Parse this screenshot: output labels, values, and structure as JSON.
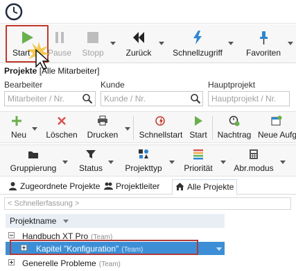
{
  "toolbar": {
    "start": "Start",
    "pause": "Pause",
    "stopp": "Stopp",
    "zurueck": "Zurück",
    "schnellzugriff": "Schnellzugriff",
    "favoriten": "Favoriten"
  },
  "section": {
    "title": "Projekte",
    "scope": "[Alle Mitarbeiter]"
  },
  "filters": {
    "bearbeiter": {
      "label": "Bearbeiter",
      "placeholder": "Mitarbeiter / Nr."
    },
    "kunde": {
      "label": "Kunde",
      "placeholder": "Kunde / Nr."
    },
    "hauptprojekt": {
      "label": "Hauptprojekt",
      "placeholder": "Hauptprojekt / Nr."
    }
  },
  "actions": {
    "neu": "Neu",
    "loeschen": "Löschen",
    "drucken": "Drucken",
    "schnellstart": "Schnellstart",
    "start": "Start",
    "nachtrag": "Nachtrag",
    "neue_aufg": "Neue Aufg"
  },
  "grouping": {
    "gruppierung": "Gruppierung",
    "status": "Status",
    "projekttyp": "Projekttyp",
    "prioritaet": "Priorität",
    "abr_modus": "Abr.modus"
  },
  "tabs": {
    "zugeordnete": "Zugeordnete Projekte",
    "projektleiter": "Projektleiter",
    "alle": "Alle Projekte"
  },
  "quick_entry": "< Schnellerfassung >",
  "tree": {
    "header": "Projektname",
    "rows": [
      {
        "name": "Handbuch XT Pro",
        "tag": "(Team)"
      },
      {
        "name": "Kapitel \"Konfiguration\"",
        "tag": "(Team)"
      },
      {
        "name": "Generelle Probleme",
        "tag": "(Team)"
      }
    ]
  },
  "colors": {
    "accent": "#3c8fd6",
    "highlight": "#c0392b",
    "play_green": "#6ab04c"
  }
}
